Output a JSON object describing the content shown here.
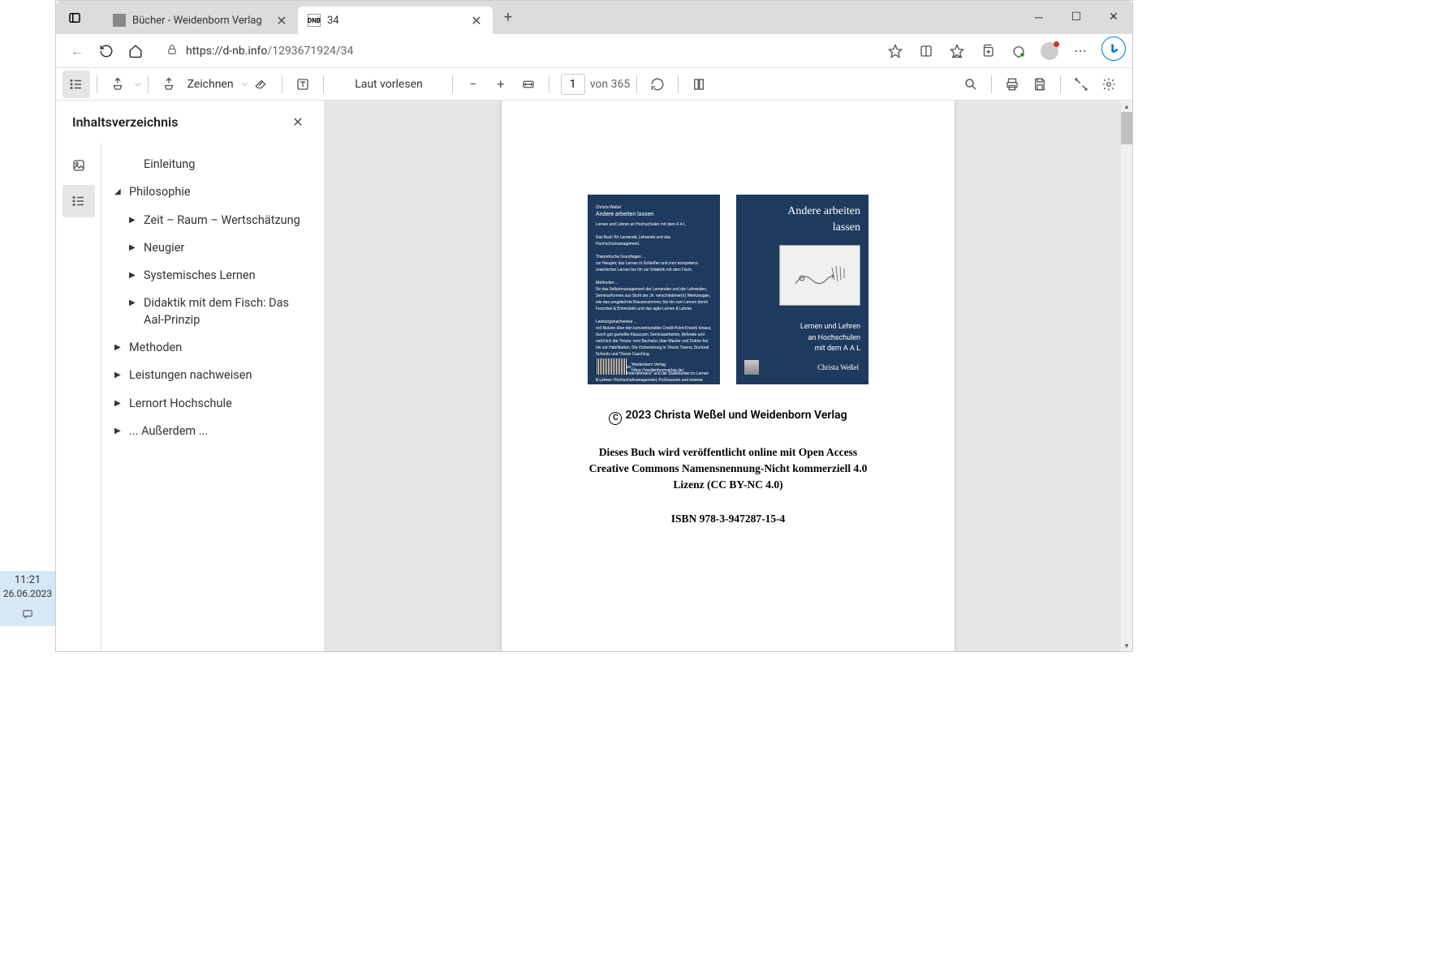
{
  "tabs": [
    {
      "title": "Bücher - Weidenborn Verlag",
      "favicon": "generic"
    },
    {
      "title": "34",
      "favicon": "DNB"
    }
  ],
  "address_bar": {
    "url_proto": "https://",
    "url_domain": "d-nb.info",
    "url_path": "/1293671924/34"
  },
  "pdf_toolbar": {
    "draw_label": "Zeichnen",
    "read_aloud": "Laut vorlesen",
    "page_current": "1",
    "page_total_prefix": "von ",
    "page_total": "365"
  },
  "sidebar": {
    "title": "Inhaltsverzeichnis",
    "toc": [
      {
        "level": 1,
        "caret": "",
        "label": "Einleitung"
      },
      {
        "level": 1,
        "caret": "down",
        "label": "Philosophie"
      },
      {
        "level": 2,
        "caret": "right",
        "label": "Zeit – Raum – Wertschätzung"
      },
      {
        "level": 2,
        "caret": "right",
        "label": "Neugier"
      },
      {
        "level": 2,
        "caret": "right",
        "label": "Systemisches Lernen"
      },
      {
        "level": 2,
        "caret": "right",
        "label": "Didaktik mit dem Fisch: Das Aal-Prinzip"
      },
      {
        "level": 1,
        "caret": "right",
        "label": "Methoden"
      },
      {
        "level": 1,
        "caret": "right",
        "label": "Leistungen nachweisen"
      },
      {
        "level": 1,
        "caret": "right",
        "label": "Lernort Hochschule"
      },
      {
        "level": 1,
        "caret": "right",
        "label": "... Außerdem ..."
      }
    ]
  },
  "page_content": {
    "cover_right": {
      "title1": "Andere arbeiten",
      "title2": "lassen",
      "sub1": "Lernen und Lehren",
      "sub2": "an Hochschulen",
      "sub3": "mit dem A A L",
      "author": "Christa Weßel"
    },
    "cover_left": {
      "author": "Christa Weßel",
      "title": "Andere arbeiten lassen",
      "subtitle": "Lernen und Lehren an Hochschulen mit dem A A L",
      "publisher": "Weidenborn Verlag"
    },
    "copyright": "2023 Christa Weßel und Weidenborn Verlag",
    "desc1": "Dieses Buch wird veröffentlicht online mit Open Access",
    "desc2": "Creative Commons Namensnennung-Nicht kommerziell 4.0",
    "desc3": "Lizenz (CC BY-NC 4.0)",
    "isbn": "ISBN 978-3-947287-15-4"
  },
  "clock": {
    "time": "11:21",
    "date": "26.06.2023"
  }
}
